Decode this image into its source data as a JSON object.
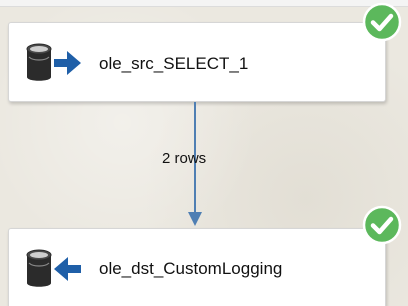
{
  "components": {
    "source": {
      "label": "ole_src_SELECT_1",
      "icon": "ole-db-source-icon",
      "status": "success-check-icon"
    },
    "destination": {
      "label": "ole_dst_CustomLogging",
      "icon": "ole-db-destination-icon",
      "status": "success-check-icon"
    }
  },
  "path": {
    "row_count_label": "2 rows"
  },
  "colors": {
    "success": "#5cb85c",
    "arrow_blue": "#1f5fa8",
    "connector": "#4f7fb3"
  }
}
